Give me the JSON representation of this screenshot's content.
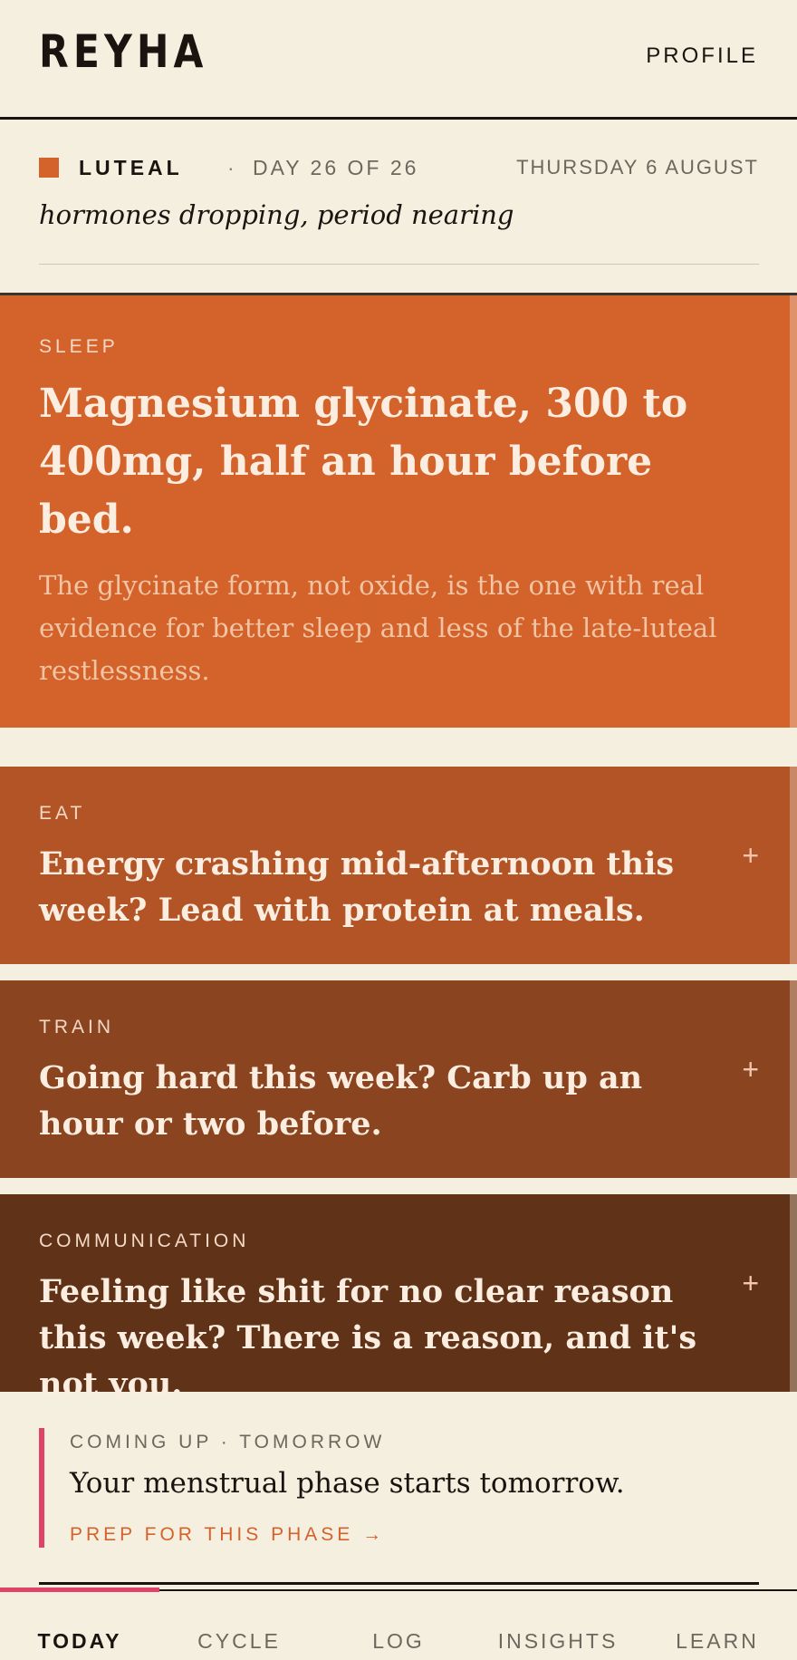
{
  "header": {
    "logo": "REYHA",
    "profile": "PROFILE"
  },
  "phase": {
    "name": "LUTEAL",
    "separator": "·",
    "day": "DAY 26 OF 26",
    "date": "THURSDAY 6 AUGUST",
    "subtitle": "hormones dropping, period nearing",
    "color": "#d4622b"
  },
  "cards": [
    {
      "label": "SLEEP",
      "title": "Magnesium glycinate, 300 to 400mg, half an hour before bed.",
      "body": "The glycinate form, not oxide, is the one with real evidence for better sleep and less of the late-luteal restlessness.",
      "color": "#d4622b"
    },
    {
      "label": "EAT",
      "title": "Energy crashing mid-afternoon this week? Lead with protein at meals.",
      "expand": "+",
      "color": "#b35426"
    },
    {
      "label": "TRAIN",
      "title": "Going hard this week? Carb up an hour or two before.",
      "expand": "+",
      "color": "#8a4420"
    },
    {
      "label": "COMMUNICATION",
      "title": "Feeling like shit for no clear reason this week? There is a reason, and it's not you.",
      "expand": "+",
      "color": "#603218"
    }
  ],
  "upcoming": {
    "label": "COMING UP · TOMORROW",
    "text": "Your menstrual phase starts tomorrow.",
    "link": "PREP FOR THIS PHASE →",
    "accent": "#e0436a"
  },
  "nav": {
    "items": [
      "TODAY",
      "CYCLE",
      "LOG",
      "INSIGHTS",
      "LEARN"
    ],
    "active": "TODAY"
  }
}
